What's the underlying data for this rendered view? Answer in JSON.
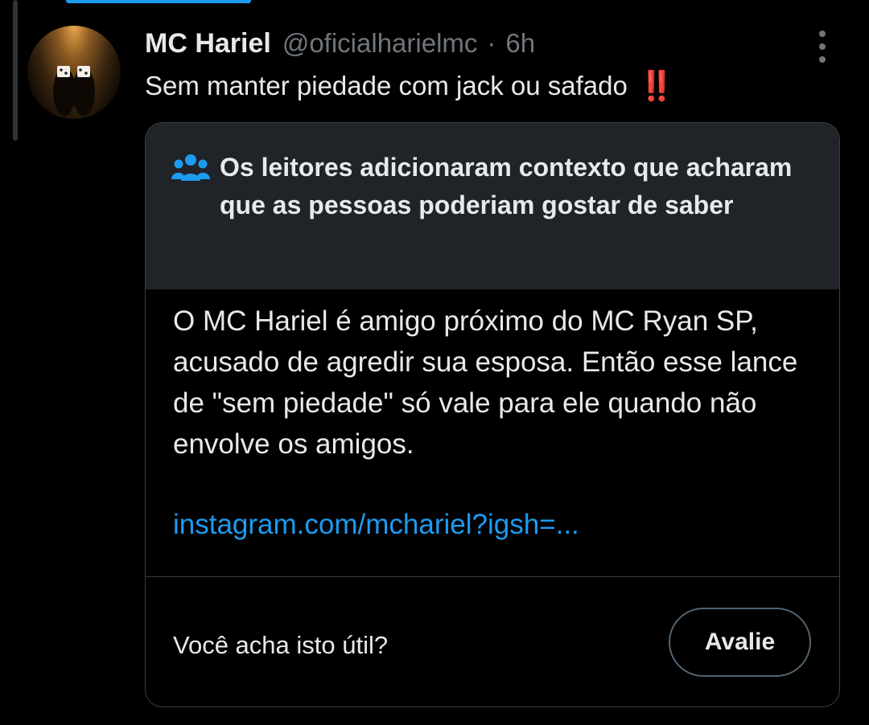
{
  "tweet": {
    "author_name": "MC Hariel",
    "author_handle": "@oficialharielmc",
    "separator": "·",
    "time": "6h",
    "text": "Sem manter piedade com jack ou safado",
    "emoji": "‼️"
  },
  "community_note": {
    "header": "Os leitores adicionaram contexto que acharam que as pessoas poderiam gostar de saber",
    "header_icon": "people-icon",
    "body": "O MC Hariel é amigo próximo do MC Ryan SP, acusado de agredir sua esposa. Então esse lance de \"sem piedade\" só vale para ele quando não envolve os amigos.",
    "link": "instagram.com/mchariel?igsh=...",
    "question": "Você acha isto útil?",
    "rate_button": "Avalie"
  },
  "colors": {
    "background": "#000000",
    "text": "#e7e9ea",
    "secondary_text": "#71767b",
    "link": "#1d9bf0",
    "note_header_bg": "#202327",
    "border": "#3a3f44"
  }
}
